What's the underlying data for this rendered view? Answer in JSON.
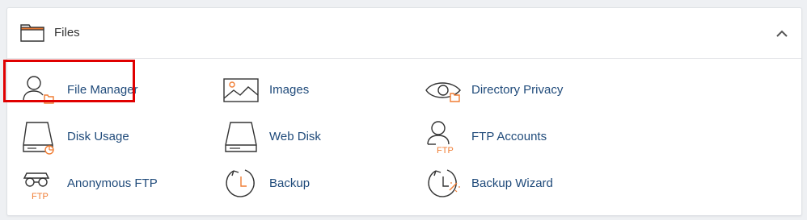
{
  "section": {
    "title": "Files",
    "icon": "folder-icon",
    "collapse_icon": "chevron-up-icon"
  },
  "items": [
    {
      "label": "File Manager",
      "icon": "file-manager-icon",
      "highlighted": true
    },
    {
      "label": "Images",
      "icon": "images-icon"
    },
    {
      "label": "Directory Privacy",
      "icon": "directory-privacy-icon"
    },
    {
      "label": "Disk Usage",
      "icon": "disk-usage-icon"
    },
    {
      "label": "Web Disk",
      "icon": "web-disk-icon"
    },
    {
      "label": "FTP Accounts",
      "icon": "ftp-accounts-icon",
      "icon_text": "FTP"
    },
    {
      "label": "Anonymous FTP",
      "icon": "anonymous-ftp-icon",
      "icon_text": "FTP"
    },
    {
      "label": "Backup",
      "icon": "backup-icon"
    },
    {
      "label": "Backup Wizard",
      "icon": "backup-wizard-icon"
    }
  ],
  "colors": {
    "accent": "#f07d34",
    "icon_stroke": "#333333",
    "link": "#1f4a7a",
    "highlight_border": "#e00000"
  }
}
